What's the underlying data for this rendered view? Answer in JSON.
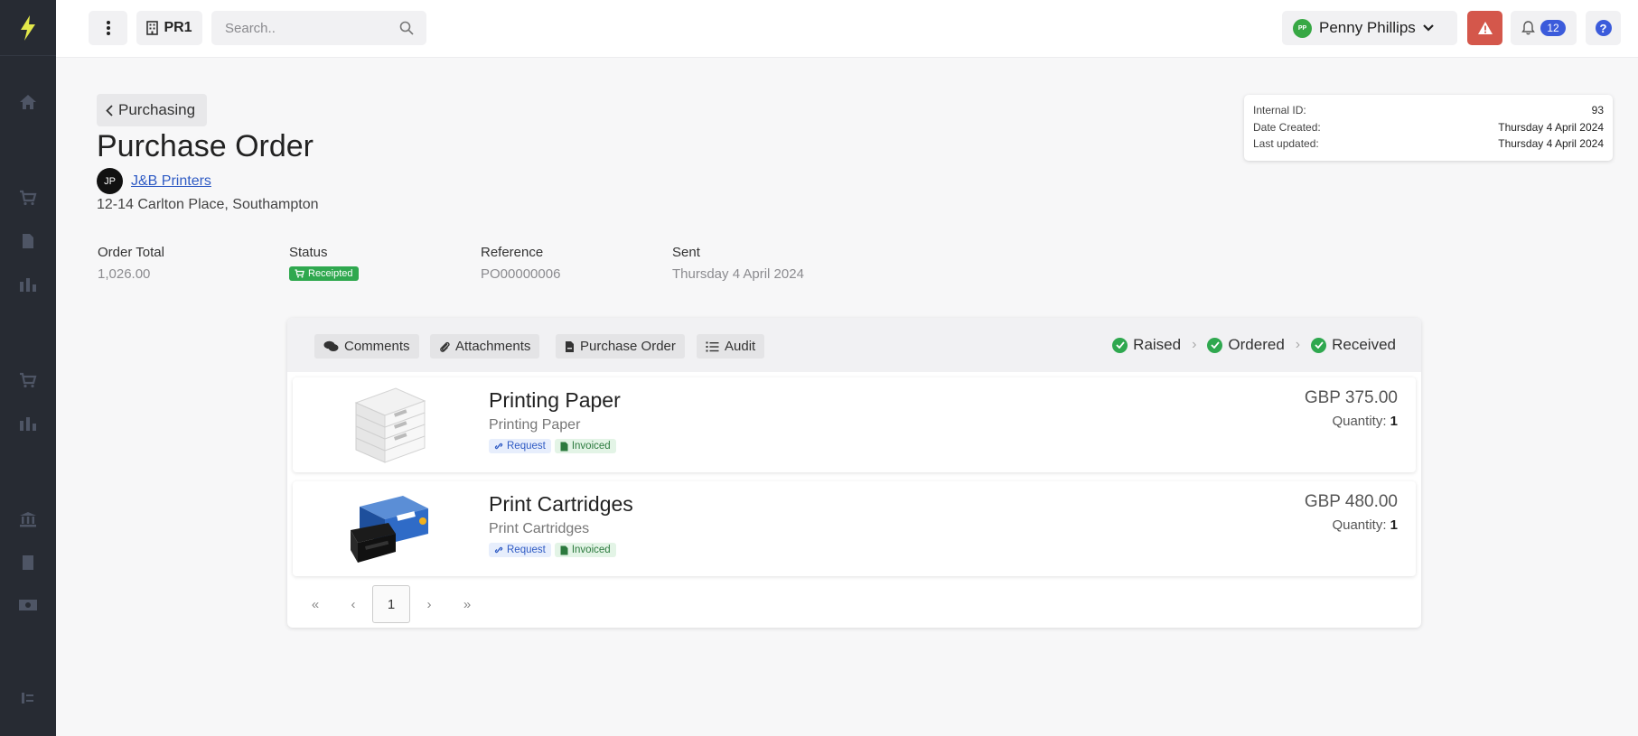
{
  "topbar": {
    "company": "PR1",
    "search_placeholder": "Search..",
    "user_initials": "PP",
    "user_name": "Penny Phillips",
    "notification_count": "12"
  },
  "header": {
    "back_label": "Purchasing",
    "title": "Purchase Order",
    "supplier_initials": "JP",
    "supplier_name": "J&B Printers",
    "supplier_address": "12-14 Carlton Place, Southampton"
  },
  "info": {
    "internal_id_label": "Internal ID:",
    "internal_id": "93",
    "date_created_label": "Date Created:",
    "date_created": "Thursday 4 April 2024",
    "last_updated_label": "Last updated:",
    "last_updated": "Thursday 4 April 2024"
  },
  "summary": {
    "order_total_label": "Order Total",
    "order_total": "1,026.00",
    "status_label": "Status",
    "status": "Receipted",
    "reference_label": "Reference",
    "reference": "PO00000006",
    "sent_label": "Sent",
    "sent": "Thursday 4 April 2024"
  },
  "tabs": [
    {
      "label": "Comments"
    },
    {
      "label": "Attachments"
    },
    {
      "label": "Purchase Order"
    },
    {
      "label": "Audit"
    }
  ],
  "stages": [
    {
      "label": "Raised"
    },
    {
      "label": "Ordered"
    },
    {
      "label": "Received"
    }
  ],
  "items": [
    {
      "name": "Printing Paper",
      "description": "Printing Paper",
      "request": "Request",
      "invoiced": "Invoiced",
      "price": "GBP 375.00",
      "qty_label": "Quantity:",
      "qty": "1"
    },
    {
      "name": "Print Cartridges",
      "description": "Print Cartridges",
      "request": "Request",
      "invoiced": "Invoiced",
      "price": "GBP 480.00",
      "qty_label": "Quantity:",
      "qty": "1"
    }
  ],
  "pager": {
    "first": "«",
    "prev": "‹",
    "page": "1",
    "next": "›",
    "last": "»"
  },
  "colors": {
    "sidebar": "#272b33",
    "accent": "#3b5bdb",
    "success": "#2fa84f",
    "alert": "#d4574b",
    "logo": "#e3e84a"
  }
}
